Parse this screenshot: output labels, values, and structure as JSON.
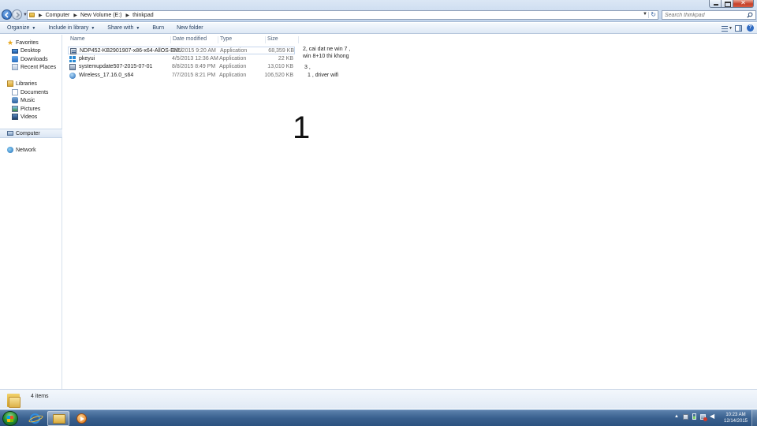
{
  "address": {
    "crumbs": [
      "Computer",
      "New Volume (E:)",
      "thinkpad"
    ]
  },
  "search": {
    "placeholder": "Search thinkpad"
  },
  "toolbar": {
    "organize": "Organize",
    "include_in_library": "Include in library",
    "share_with": "Share with",
    "burn": "Burn",
    "new_folder": "New folder"
  },
  "nav": {
    "favorites": "Favorites",
    "desktop": "Desktop",
    "downloads": "Downloads",
    "recent_places": "Recent Places",
    "libraries": "Libraries",
    "documents": "Documents",
    "music": "Music",
    "pictures": "Pictures",
    "videos": "Videos",
    "computer": "Computer",
    "network": "Network"
  },
  "columns": {
    "name": "Name",
    "date_modified": "Date modified",
    "type": "Type",
    "size": "Size"
  },
  "files": [
    {
      "name": "NDP452-KB2901907-x86-x64-AllOS-ENU",
      "date": "8/7/2015 9:20 AM",
      "type": "Application",
      "size": "68,359 KB",
      "icon": "installer-icon"
    },
    {
      "name": "pkeyui",
      "date": "4/5/2013 12:36 AM",
      "type": "Application",
      "size": "22 KB",
      "icon": "windows-logo-icon"
    },
    {
      "name": "systemupdate507-2015-07-01",
      "date": "8/8/2015 8:49 PM",
      "type": "Application",
      "size": "13,010 KB",
      "icon": "system-update-icon"
    },
    {
      "name": "Wireless_17.16.0_s64",
      "date": "7/7/2015 8:21 PM",
      "type": "Application",
      "size": "106,520 KB",
      "icon": "wireless-driver-icon"
    }
  ],
  "annotations": {
    "note1_line1": "2, cai dat ne win 7 ,",
    "note1_line2": "win 8+10 thi khong",
    "note2": "3 ,",
    "note3": "1 , driver wifi",
    "big_number": "1"
  },
  "status": {
    "item_count": "4 items"
  },
  "clock": {
    "time": "10:23 AM",
    "date": "12/14/2015"
  },
  "colors": {
    "titlebar": "#c3d5ec",
    "taskbar": "#39608e",
    "link_text": "#1e395b"
  }
}
